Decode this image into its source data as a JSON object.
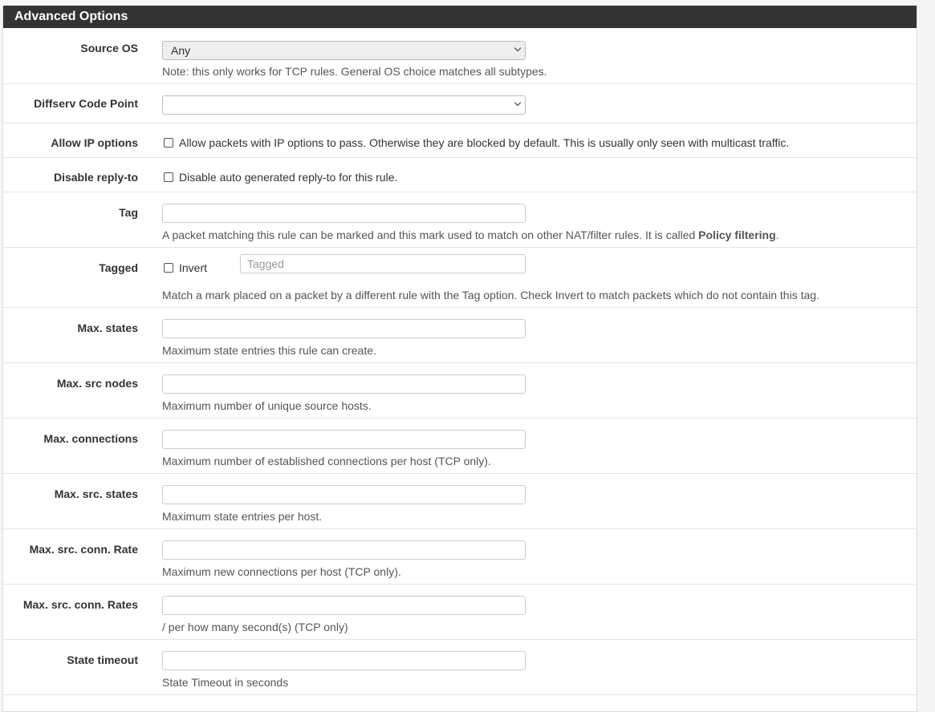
{
  "panel": {
    "title": "Advanced Options"
  },
  "fields": {
    "source_os": {
      "label": "Source OS",
      "selected": "Any",
      "help": "Note: this only works for TCP rules. General OS choice matches all subtypes."
    },
    "dscp": {
      "label": "Diffserv Code Point",
      "selected": ""
    },
    "allow_ip_options": {
      "label": "Allow IP options",
      "checkbox_text": "Allow packets with IP options to pass. Otherwise they are blocked by default. This is usually only seen with multicast traffic."
    },
    "disable_replyto": {
      "label": "Disable reply-to",
      "checkbox_text": "Disable auto generated reply-to for this rule."
    },
    "tag": {
      "label": "Tag",
      "value": "",
      "help_prefix": "A packet matching this rule can be marked and this mark used to match on other NAT/filter rules. It is called ",
      "help_bold": "Policy filtering",
      "help_suffix": "."
    },
    "tagged": {
      "label": "Tagged",
      "invert_label": "Invert",
      "placeholder": "Tagged",
      "help": "Match a mark placed on a packet by a different rule with the Tag option. Check Invert to match packets which do not contain this tag."
    },
    "max_states": {
      "label": "Max. states",
      "value": "",
      "help": "Maximum state entries this rule can create."
    },
    "max_src_nodes": {
      "label": "Max. src nodes",
      "value": "",
      "help": "Maximum number of unique source hosts."
    },
    "max_connections": {
      "label": "Max. connections",
      "value": "",
      "help": "Maximum number of established connections per host (TCP only)."
    },
    "max_src_states": {
      "label": "Max. src. states",
      "value": "",
      "help": "Maximum state entries per host."
    },
    "max_src_conn_rate": {
      "label": "Max. src. conn. Rate",
      "value": "",
      "help": "Maximum new connections per host (TCP only)."
    },
    "max_src_conn_rates": {
      "label": "Max. src. conn. Rates",
      "value": "",
      "help": "/ per how many second(s) (TCP only)"
    },
    "state_timeout": {
      "label": "State timeout",
      "value": "",
      "help": "State Timeout in seconds"
    }
  }
}
